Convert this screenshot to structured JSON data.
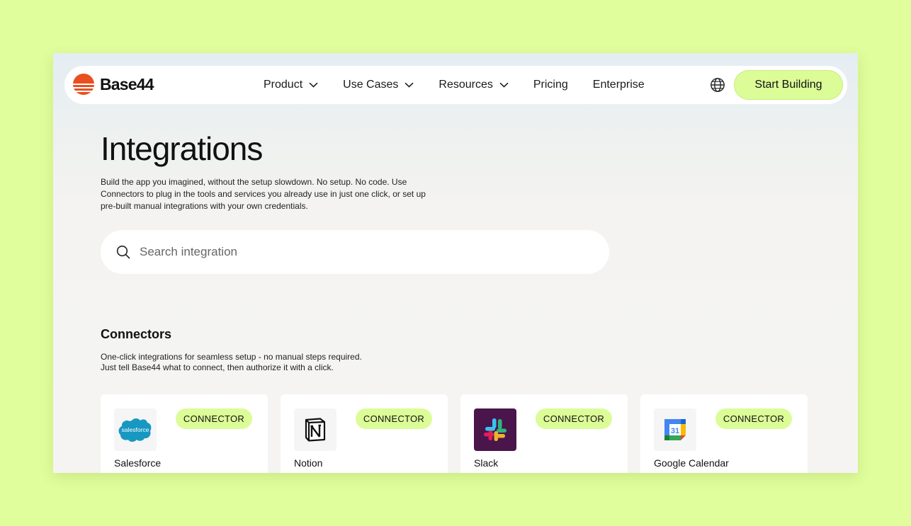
{
  "brand": {
    "name": "Base44",
    "accent": "#ea4f1f"
  },
  "nav": {
    "items": [
      {
        "label": "Product",
        "dropdown": true
      },
      {
        "label": "Use Cases",
        "dropdown": true
      },
      {
        "label": "Resources",
        "dropdown": true
      },
      {
        "label": "Pricing",
        "dropdown": false
      },
      {
        "label": "Enterprise",
        "dropdown": false
      }
    ],
    "language_icon": "globe-icon",
    "cta_label": "Start Building"
  },
  "page": {
    "title": "Integrations",
    "description": "Build the app you imagined, without the setup slowdown. No setup. No code. Use Connectors to plug in the tools and services you already use in just one click, or set up pre-built manual integrations with your own credentials."
  },
  "search": {
    "placeholder": "Search integration",
    "value": ""
  },
  "connectors": {
    "title": "Connectors",
    "description_line1": "One-click integrations for seamless setup - no manual steps required.",
    "description_line2": "Just tell Base44 what to connect, then authorize it with a click.",
    "cards": [
      {
        "name": "Salesforce",
        "badge": "CONNECTOR",
        "icon": "salesforce-logo-icon",
        "logo_text": "salesforce"
      },
      {
        "name": "Notion",
        "badge": "CONNECTOR",
        "icon": "notion-logo-icon"
      },
      {
        "name": "Slack",
        "badge": "CONNECTOR",
        "icon": "slack-logo-icon"
      },
      {
        "name": "Google Calendar",
        "badge": "CONNECTOR",
        "icon": "google-calendar-logo-icon",
        "logo_text": "31"
      }
    ]
  },
  "colors": {
    "page_bg": "#e0fe9b",
    "badge_bg": "#dcfc98",
    "cta_bg": "#dcfc98"
  }
}
